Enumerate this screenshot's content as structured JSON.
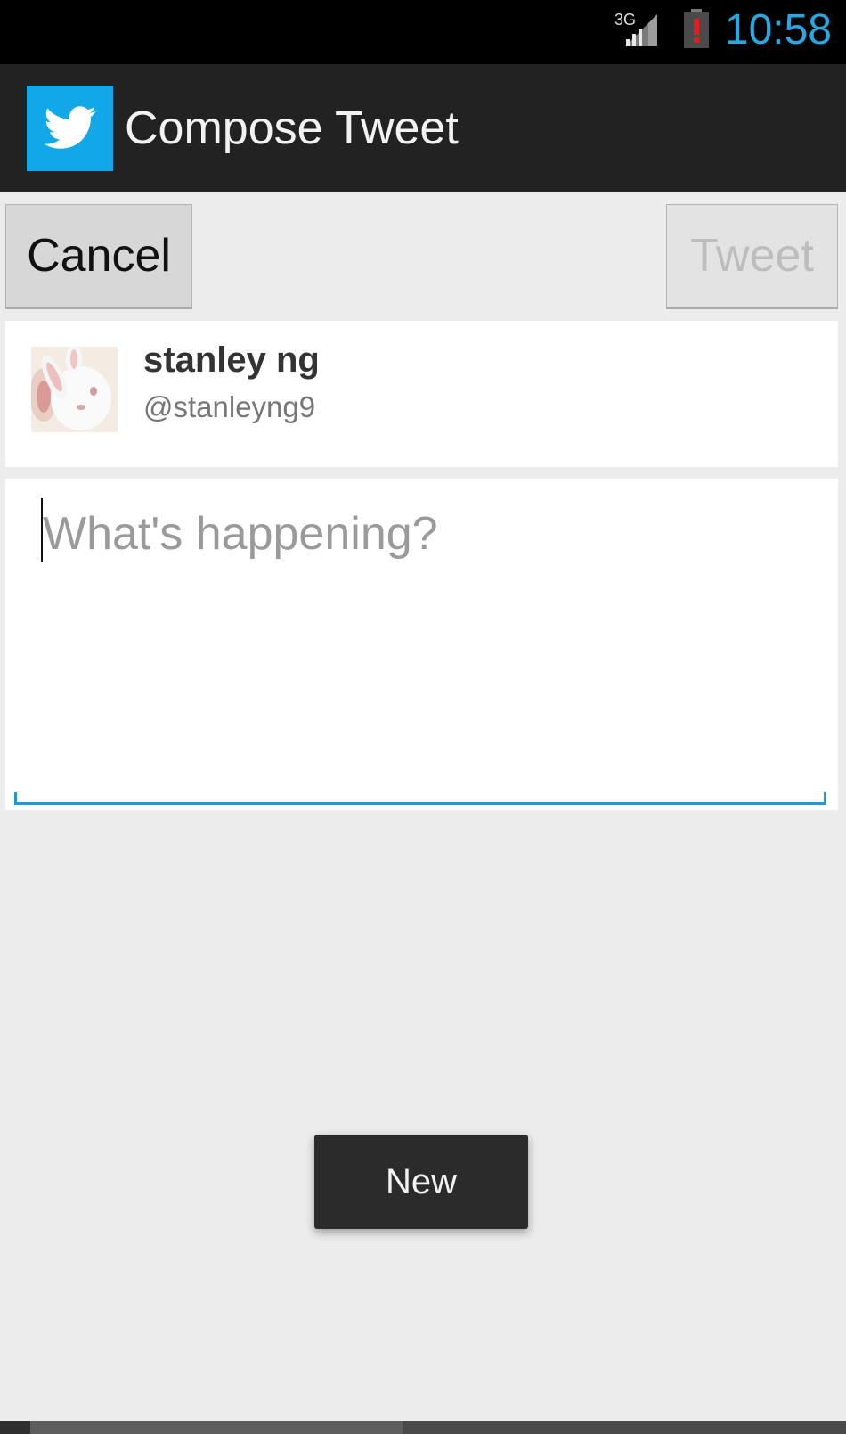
{
  "status_bar": {
    "network_label": "3G",
    "time": "10:58",
    "time_color": "#2aa6e0",
    "icons": [
      "signal-icon",
      "battery-alert-icon"
    ]
  },
  "action_bar": {
    "title": "Compose Tweet",
    "app_icon": "twitter-bird-icon",
    "brand_color": "#12a7e6"
  },
  "buttons": {
    "cancel_label": "Cancel",
    "tweet_label": "Tweet"
  },
  "user": {
    "name": "stanley ng",
    "handle": "@stanleyng9",
    "avatar": "rabbit-avatar"
  },
  "compose": {
    "placeholder": "What's happening?",
    "value": "",
    "focus_color": "#1e9bd3"
  },
  "toast": {
    "message": "New"
  }
}
